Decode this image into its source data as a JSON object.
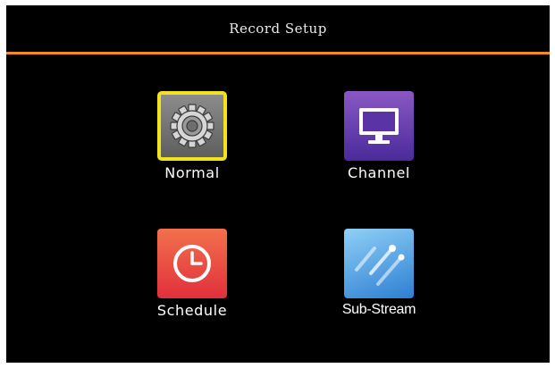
{
  "header": {
    "title": "Record Setup"
  },
  "menu": {
    "selected": "normal",
    "items": [
      {
        "id": "normal",
        "label": "Normal",
        "icon": "gear-icon",
        "color": "#6e6e6e"
      },
      {
        "id": "channel",
        "label": "Channel",
        "icon": "monitor-icon",
        "color": "#6a3fb0"
      },
      {
        "id": "schedule",
        "label": "Schedule",
        "icon": "clock-icon",
        "color": "#ea4a40"
      },
      {
        "id": "substream",
        "label": "Sub-Stream",
        "icon": "streams-icon",
        "color": "#4a9ae0"
      }
    ]
  },
  "colors": {
    "background": "#000000",
    "accent_rule": "#f28c1e",
    "selection_border": "#f3e21c",
    "text": "#ffffff"
  }
}
